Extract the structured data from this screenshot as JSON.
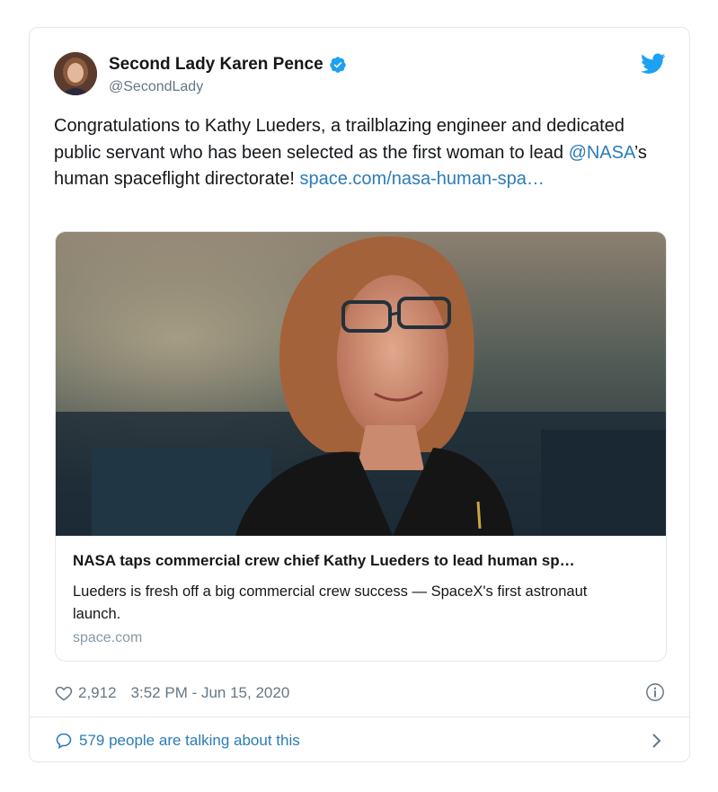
{
  "tweet": {
    "author_name": "Second Lady Karen Pence",
    "handle": "@SecondLady",
    "text_part1": "Congratulations to Kathy Lueders, a trailblazing engineer and dedicated public servant who has been selected as the first woman to lead ",
    "mention": "@NASA",
    "text_part2": "’s human spaceflight directorate! ",
    "link_text": "space.com/nasa-human-spa…",
    "link_card": {
      "title": "NASA taps commercial crew chief Kathy Lueders to lead human sp…",
      "description": "Lueders is fresh off a big commercial crew success — SpaceX's first astronaut launch.",
      "domain": "space.com"
    },
    "likes": "2,912",
    "timestamp": "3:52 PM - Jun 15, 2020",
    "talking": "579 people are talking about this"
  },
  "colors": {
    "brand_blue": "#1da1f2",
    "link_blue": "#2b7bb9",
    "muted_gray": "#657786"
  },
  "icons": [
    "verified-badge-icon",
    "twitter-bird-icon",
    "heart-icon",
    "info-icon",
    "speech-bubble-icon",
    "chevron-right-icon"
  ]
}
